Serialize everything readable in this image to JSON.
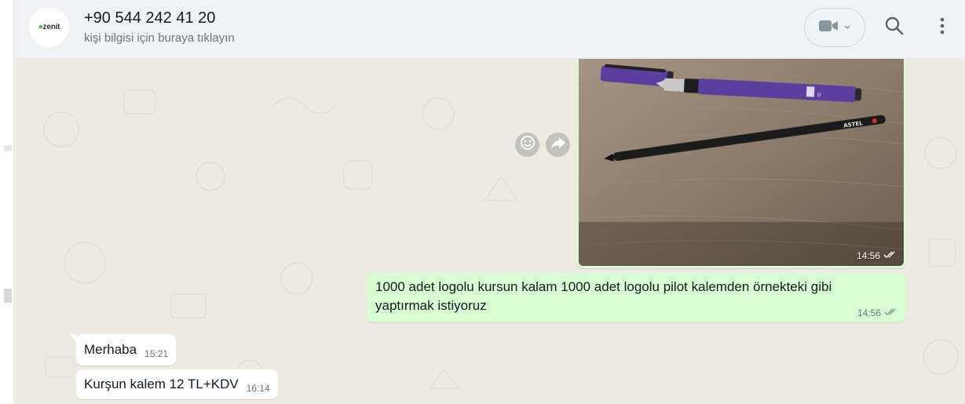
{
  "header": {
    "avatar_text": "zenit",
    "contact_name": "+90 544 242 41 20",
    "contact_hint": "kişi bilgisi için buraya tıklayın",
    "video_icon": "video-camera-icon",
    "search_icon": "search-icon",
    "menu_icon": "more-vertical-icon"
  },
  "messages": [
    {
      "kind": "image",
      "direction": "outgoing",
      "time": "14:56",
      "status": "read"
    },
    {
      "kind": "text",
      "direction": "outgoing",
      "text": "1000 adet logolu kursun kalam 1000 adet logolu pilot kalemden örnekteki gibi yaptırmak istiyoruz",
      "time": "14:56",
      "status": "read"
    },
    {
      "kind": "text",
      "direction": "incoming",
      "text": "Merhaba",
      "time": "15:21"
    },
    {
      "kind": "text",
      "direction": "incoming",
      "text": "Kurşun kalem 12 TL+KDV",
      "time": "16:14"
    }
  ],
  "photo_text": {
    "pencil_brand": "ASTEL",
    "pen_logo": "D"
  },
  "colors": {
    "outgoing_bubble": "#d9fdd3",
    "incoming_bubble": "#ffffff",
    "chat_bg": "#efeae2",
    "header_bg": "#f0f2f5"
  }
}
